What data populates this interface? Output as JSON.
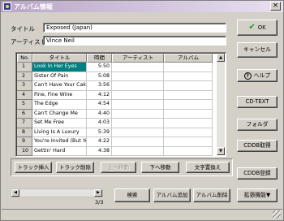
{
  "window": {
    "title": "アルバム情報",
    "close_label": "×"
  },
  "form": {
    "title_label": "タイトル",
    "title_value": "Exposed (Japan)",
    "artist_label": "アーティスト",
    "artist_value": "Vince Neil"
  },
  "table": {
    "columns": [
      "No.",
      "タイトル",
      "時間",
      "アーティスト",
      "アルバム"
    ],
    "rows": [
      {
        "no": "1",
        "title": "Look In Her Eyes",
        "time": "5:50",
        "artist": "",
        "album": ""
      },
      {
        "no": "2",
        "title": "Sister Of Pain",
        "time": "5:08",
        "artist": "",
        "album": ""
      },
      {
        "no": "3",
        "title": "Can't Have Your Cake",
        "time": "3:56",
        "artist": "",
        "album": ""
      },
      {
        "no": "4",
        "title": "Fine, Fine Wine",
        "time": "4:12",
        "artist": "",
        "album": ""
      },
      {
        "no": "5",
        "title": "The Edge",
        "time": "4:54",
        "artist": "",
        "album": ""
      },
      {
        "no": "6",
        "title": "Can't Change Me",
        "time": "4:40",
        "artist": "",
        "album": ""
      },
      {
        "no": "7",
        "title": "Set Me Free",
        "time": "4:03",
        "artist": "",
        "album": ""
      },
      {
        "no": "8",
        "title": "Living Is A Luxury",
        "time": "5:39",
        "artist": "",
        "album": ""
      },
      {
        "no": "9",
        "title": "You're Invited (But Yo",
        "time": "4:22",
        "artist": "",
        "album": ""
      },
      {
        "no": "10",
        "title": "Gettin' Hard",
        "time": "4:38",
        "artist": "",
        "album": ""
      }
    ],
    "selected_row": 1
  },
  "track_buttons": {
    "insert": "トラック挿入",
    "delete": "トラック削除",
    "move_up": "上へ移動",
    "move_down": "下へ移動",
    "replace_text": "文字置換え"
  },
  "side_buttons": {
    "ok": "OK",
    "cancel": "キャンセル",
    "help": "ヘルプ",
    "cd_text": "CD-TEXT",
    "folder": "フォルダ",
    "cddb_get": "CDDB取得",
    "cddb_register": "CDDB登録",
    "extensions": "拡張機能▼"
  },
  "bottom_buttons": {
    "search": "検索",
    "add_album": "アルバム追加",
    "remove_album": "アルバム削除"
  },
  "pagination": {
    "text": "3/3"
  },
  "icons": {
    "ok": "check-icon",
    "help": "question-icon",
    "scroll_up": "arrow-up-icon",
    "scroll_down": "arrow-down-icon",
    "scroll_left": "arrow-left-icon",
    "scroll_right": "arrow-right-icon"
  },
  "colors": {
    "selection": "#008080",
    "face": "#d4d0c8",
    "ok_check": "#1c9a2a"
  }
}
